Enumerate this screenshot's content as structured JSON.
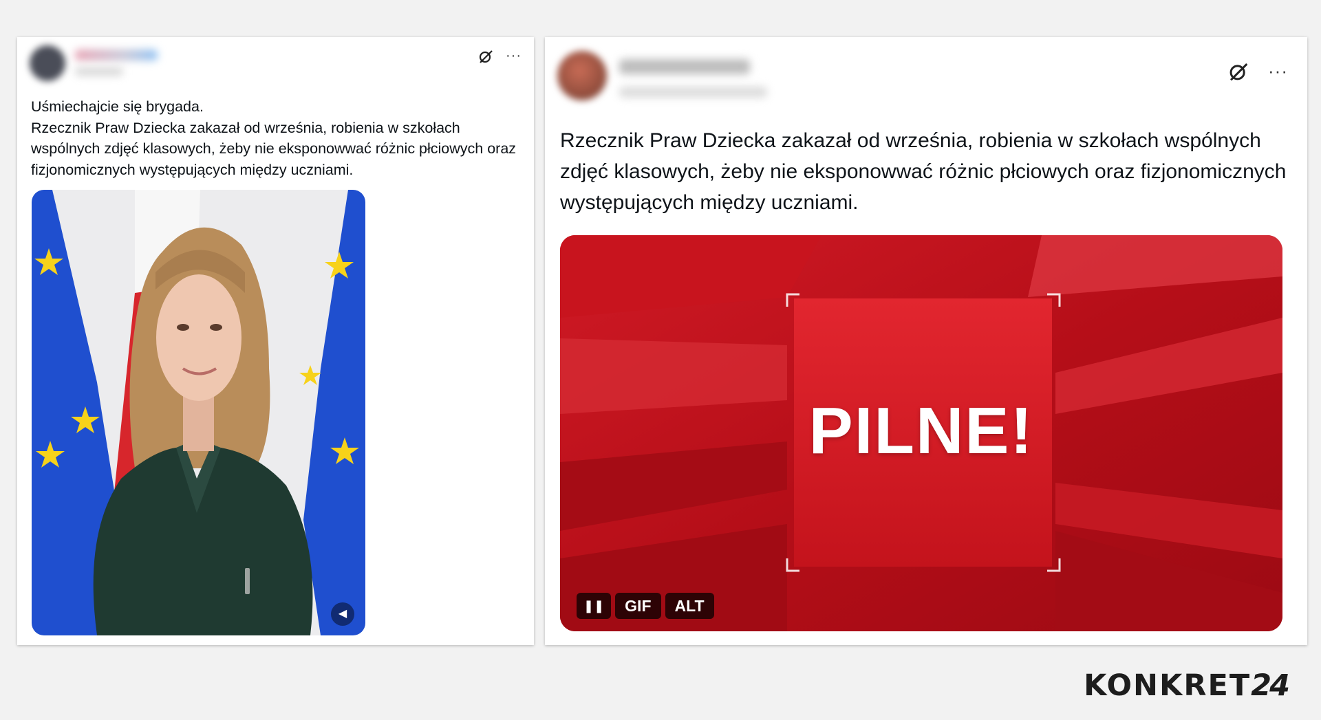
{
  "left_post": {
    "text": "Uśmiechajcie się brygada.\nRzecznik Praw Dziecka zakazał od września, robienia w szkołach wspólnych zdjęć klasowych, żeby nie eksponowwać różnic płciowych oraz fizjonomicznych występujących między uczniami.",
    "more_label": "···",
    "media_icon": "sound-icon"
  },
  "right_post": {
    "text": "Rzecznik Praw Dziecka zakazał od września, robienia w szkołach wspólnych zdjęć klasowych, żeby nie eksponowwać różnic płciowych oraz fizjonomicznych występujących między uczniami.",
    "more_label": "···",
    "gif_text": "PILNE!",
    "badges": {
      "pause": "❚❚",
      "gif": "GIF",
      "alt": "ALT"
    }
  },
  "logo": {
    "word": "KONKRET",
    "number": "24"
  },
  "colors": {
    "gif_red": "#c8141e",
    "eu_blue": "#1f4fcf",
    "star_yellow": "#f7d21a",
    "jacket_green": "#1f3a31"
  }
}
